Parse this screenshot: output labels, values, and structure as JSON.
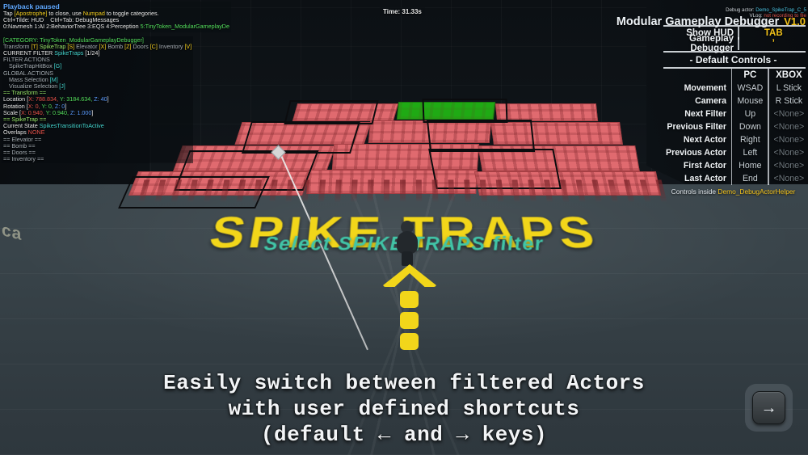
{
  "scene": {
    "decal_title": "SPIKE TRAPS",
    "decal_subtitle": "Select SPIKE TRAPS  filter",
    "wall_label": "ca",
    "arrow_icon": "up-arrow-marker"
  },
  "time_indicator": "Time: 31.33s",
  "debug_hud": {
    "playback_status": "Playback paused",
    "hint_line": "Tap [Apostrophe] to close, use Numpad to toggle categories.",
    "toggle_line_a": "Ctrl+Tilde: HUD",
    "toggle_line_b": "Ctrl+Tab: DebugMessages",
    "categories": [
      {
        "num": "0:",
        "name": "Navmesh"
      },
      {
        "num": "1:",
        "name": "AI"
      },
      {
        "num": "2:",
        "name": "BehaviorTree"
      },
      {
        "num": "3:",
        "name": "EQS"
      },
      {
        "num": "4:",
        "name": "Perception"
      },
      {
        "num": "5:",
        "name": "TinyToken_ModularGameplayDe"
      }
    ],
    "category_header": "[CATEGORY: TinyToken_ModularGameplayDebugger]",
    "filters_line": "Transform [T]  SpikeTrap [S]  Elevator [X]  Bomb [Z]  Doors [C]  Inventory [V]",
    "current_filter_label": "CURRENT FILTER",
    "current_filter_value": "SpikeTraps",
    "current_filter_count": "[1/24]",
    "filter_actions_label": "FILTER ACTIONS",
    "filter_action_item": "SpikeTrapHitBox",
    "filter_action_key": "[G]",
    "global_actions_label": "GLOBAL ACTIONS",
    "global_actions": [
      {
        "name": "Mass Selection",
        "key": "[M]"
      },
      {
        "name": "Visualize Selection",
        "key": "[J]"
      }
    ],
    "section_transform": "== Transform ==",
    "transform_rows": [
      {
        "label": "Location",
        "x": "X: 788.834,",
        "y": "Y: 3184.634,",
        "z": "Z: 40"
      },
      {
        "label": "Rotation",
        "x": "X: 0,",
        "y": "Y: 0,",
        "z": "Z: 0"
      },
      {
        "label": "Scale",
        "x": "X: 0.940,",
        "y": "Y: 0.940,",
        "z": "Z: 1.000"
      }
    ],
    "section_spiketrap": "== SpikeTrap ==",
    "state_label": "Current State",
    "state_value": "SpikesTransitionToActive",
    "overlaps_label": "Overlaps",
    "overlaps_value": "NONE",
    "sections_collapsed": [
      "== Elevator ==",
      "== Bomb ==",
      "== Doors ==",
      "== Inventory =="
    ]
  },
  "panel": {
    "debug_actor_label": "Debug actor:",
    "debug_actor_value": "Demo_SpikeTrap_C_5",
    "vlog_label": "VLog:",
    "vlog_value": "not recording to file",
    "title": "Modular Gameplay Debugger",
    "version": "V1.0",
    "bindings": [
      {
        "label": "Show HUD",
        "value": "TAB"
      },
      {
        "label": "Gameplay Debugger",
        "value": "’"
      }
    ],
    "defaults_header": "- Default Controls -",
    "columns": {
      "name": "",
      "pc": "PC",
      "xbox": "XBOX"
    },
    "controls": [
      {
        "name": "Movement",
        "pc": "WSAD",
        "xbox": "L Stick"
      },
      {
        "name": "Camera",
        "pc": "Mouse",
        "xbox": "R Stick"
      },
      {
        "name": "Next Filter",
        "pc": "Up",
        "xbox": "<None>"
      },
      {
        "name": "Previous Filter",
        "pc": "Down",
        "xbox": "<None>"
      },
      {
        "name": "Next Actor",
        "pc": "Right",
        "xbox": "<None>"
      },
      {
        "name": "Previous Actor",
        "pc": "Left",
        "xbox": "<None>"
      },
      {
        "name": "First Actor",
        "pc": "Home",
        "xbox": "<None>"
      },
      {
        "name": "Last Actor",
        "pc": "End",
        "xbox": "<None>"
      }
    ],
    "footer_text": "Controls inside",
    "footer_highlight": "Demo_DebugActorHelper"
  },
  "caption": {
    "line1": "Easily switch between filtered Actors",
    "line2": "with user defined shortcuts",
    "line3": "(default ← and → keys)"
  },
  "next_button": {
    "glyph": "→",
    "name": "next-slide-button"
  },
  "colors": {
    "accent_yellow": "#f2c21a",
    "decal_yellow": "#f2d61a",
    "teal": "#41c6a8",
    "platform_red": "#e06a6f",
    "platform_green": "#1faa14",
    "status_blue": "#5fa8ff"
  }
}
